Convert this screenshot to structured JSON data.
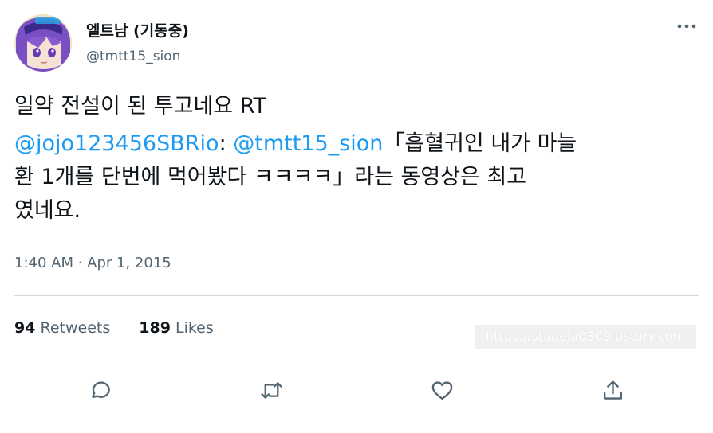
{
  "author": {
    "display_name": "엘트남 (기동중)",
    "handle": "@tmtt15_sion",
    "avatar_icon": "anime-avatar-icon"
  },
  "tweet": {
    "line1": "일약 전설이 된 투고네요 RT",
    "quote_mention_1": "@jojo123456SBRio",
    "quote_sep": ": ",
    "quote_mention_2": "@tmtt15_sion",
    "quote_line1_rest": "「흡혈귀인 내가 마늘",
    "quote_line2": "환 1개를 단번에 먹어봤다 ㅋㅋㅋㅋ」라는 동영상은 최고",
    "quote_line3": "였네요."
  },
  "timestamp": "1:40 AM · Apr 1, 2015",
  "stats": {
    "retweets_count": "94",
    "retweets_label": "Retweets",
    "likes_count": "189",
    "likes_label": "Likes"
  },
  "watermark": "https://stadela0309.tistory.com",
  "actions": [
    {
      "name": "reply",
      "icon": "reply-icon"
    },
    {
      "name": "retweet",
      "icon": "retweet-icon"
    },
    {
      "name": "like",
      "icon": "heart-icon"
    },
    {
      "name": "share",
      "icon": "share-icon"
    }
  ],
  "colors": {
    "accent": "#1d9bf0",
    "text": "#0f1419",
    "secondary": "#536471",
    "divider": "#cfd9de"
  }
}
